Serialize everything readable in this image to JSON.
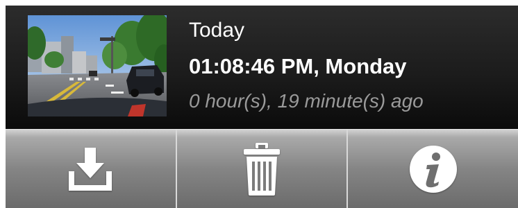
{
  "recording": {
    "date_label": "Today",
    "time_label": "01:08:46 PM, Monday",
    "elapsed_label": "0 hour(s), 19 minute(s) ago",
    "thumbnail_icon": "dashcam-street-scene"
  },
  "toolbar": {
    "buttons": [
      {
        "icon": "download-icon"
      },
      {
        "icon": "trash-icon"
      },
      {
        "icon": "info-icon"
      }
    ]
  },
  "colors": {
    "panel_top": "#2c2c2c",
    "panel_bottom": "#0b0b0b",
    "toolbar_top": "#a9a9a9",
    "toolbar_bottom": "#6b6b6b",
    "primary_text": "#ffffff",
    "secondary_text": "#9a9a9a"
  }
}
